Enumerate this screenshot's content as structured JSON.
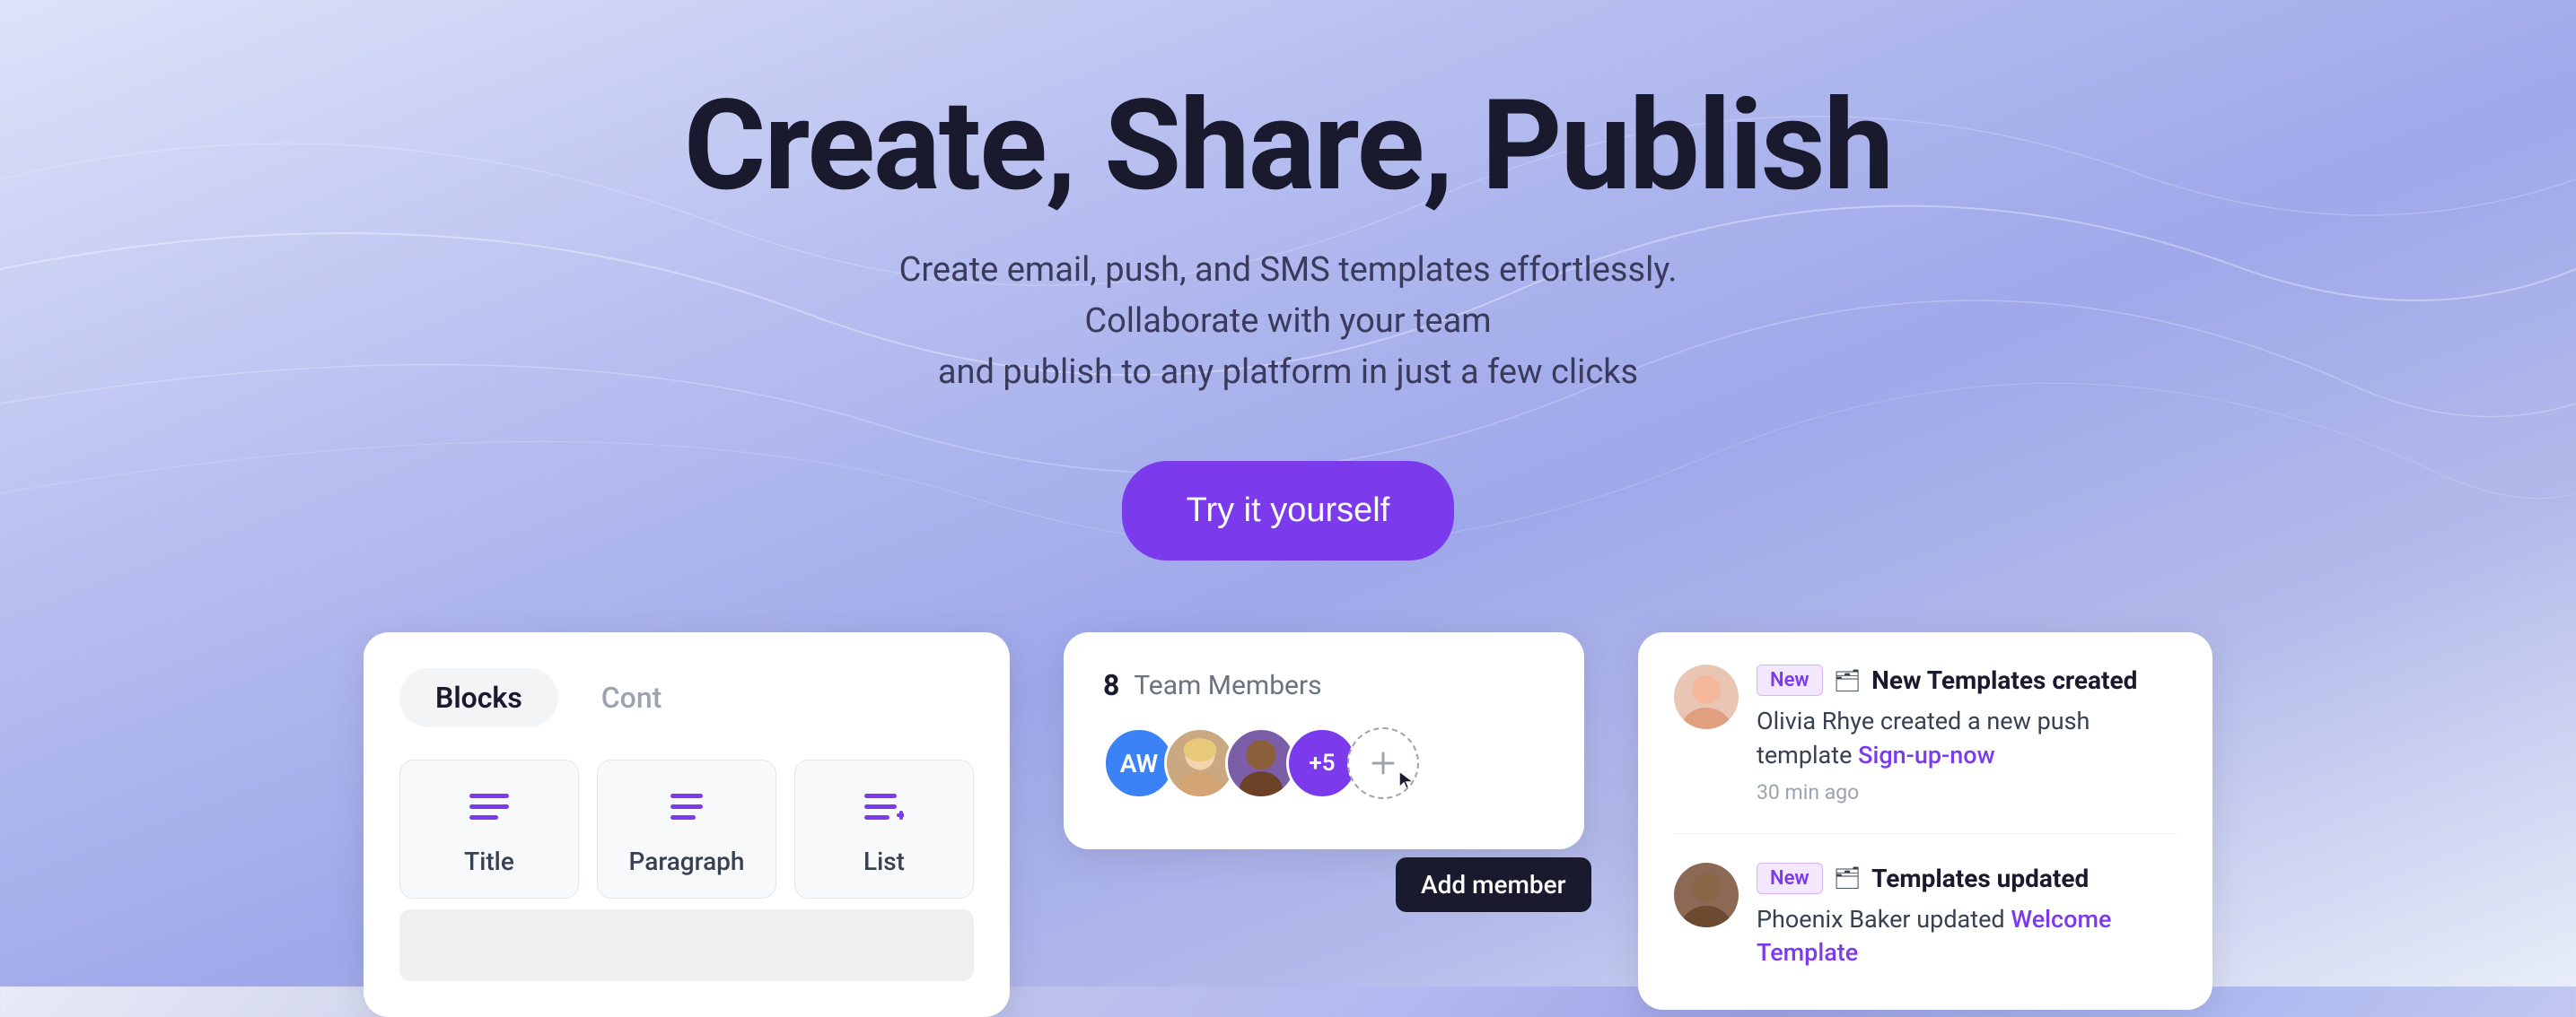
{
  "hero": {
    "title": "Create, Share, Publish",
    "subtitle_line1": "Create email, push, and SMS templates effortlessly. Collaborate with your team",
    "subtitle_line2": "and publish to any platform in just a few clicks",
    "cta_label": "Try it yourself"
  },
  "editor_card": {
    "tab_blocks": "Blocks",
    "tab_content": "Cont",
    "blocks": [
      {
        "label": "Title",
        "icon": "≡"
      },
      {
        "label": "Paragraph",
        "icon": "≡"
      },
      {
        "label": "List",
        "icon": "≡+"
      }
    ]
  },
  "team_card": {
    "count": "8",
    "label": "Team Members",
    "tooltip": "Add member",
    "plus_count": "+5"
  },
  "notifications": {
    "items": [
      {
        "badge": "New",
        "type_icon": "🗂",
        "title": "New Templates created",
        "text_before": "Olivia Rhye created a new push template",
        "link_text": "Sign-up-now",
        "time": "30 min ago"
      },
      {
        "badge": "New",
        "type_icon": "🗂",
        "title": "Templates updated",
        "text_before": "Phoenix Baker updated",
        "link_text": "Welcome Template",
        "time": ""
      }
    ]
  },
  "colors": {
    "accent": "#7c3aed",
    "accent_light": "#f3e8ff",
    "text_dark": "#1a1a2e",
    "text_muted": "#9ca3af",
    "link": "#7c3aed"
  }
}
